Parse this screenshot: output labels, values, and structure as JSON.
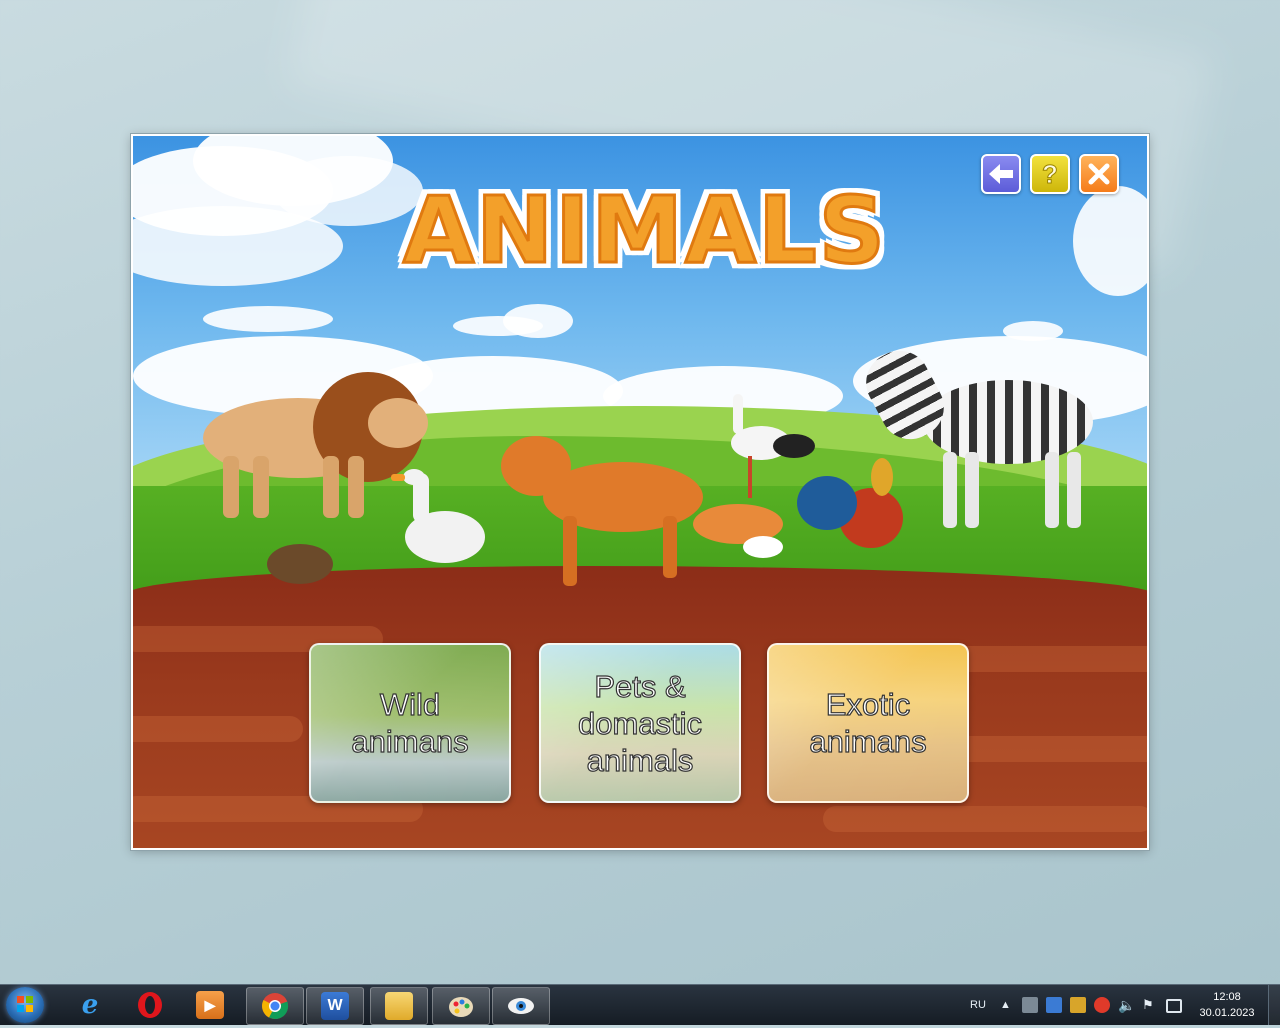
{
  "app": {
    "title": "ANIMALS",
    "toolbar": {
      "back_icon": "arrow-left-icon",
      "help_label": "?",
      "close_icon": "close-icon"
    },
    "categories": [
      {
        "label_line1": "Wild",
        "label_line2": "animans"
      },
      {
        "label_line1": "Pets &",
        "label_line2": "domastic",
        "label_line3": "animals"
      },
      {
        "label_line1": "Exotic",
        "label_line2": "animans"
      }
    ],
    "colors": {
      "title_fill": "#f3a02a",
      "title_outline": "#e07a10",
      "back": "#6b6be0",
      "help": "#e0cc1e",
      "close": "#f58a2a"
    }
  },
  "taskbar": {
    "apps": [
      "internet-explorer",
      "opera",
      "media-player",
      "chrome",
      "word",
      "file-explorer",
      "paint",
      "viewer"
    ],
    "word_label": "W",
    "opera_label": "O",
    "language": "RU",
    "time": "12:08",
    "date": "30.01.2023"
  }
}
